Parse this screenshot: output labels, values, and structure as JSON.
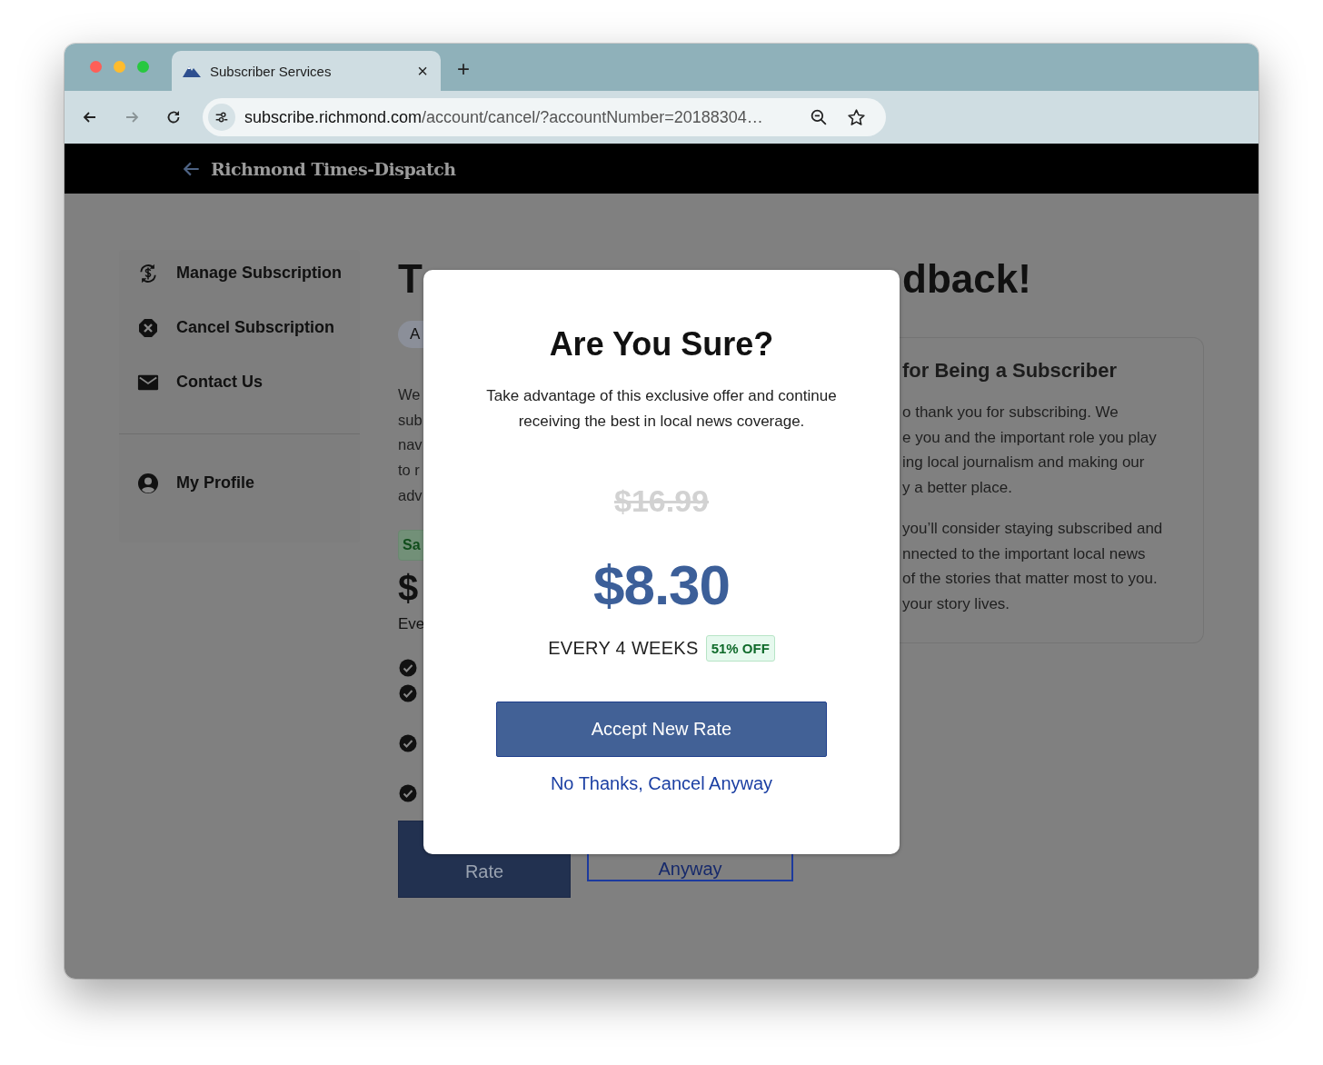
{
  "browser": {
    "tab": {
      "title": "Subscriber Services",
      "close": "×",
      "selected": true
    },
    "new_tab": "+",
    "url": {
      "host": "subscribe.richmond.com",
      "path": "/account/cancel/?accountNumber=20188304…"
    }
  },
  "header": {
    "logo": "Richmond Times-Dispatch"
  },
  "sidebar": {
    "items": [
      {
        "kind": "manage",
        "label": "Manage Subscription"
      },
      {
        "kind": "cancel",
        "label": "Cancel Subscription"
      },
      {
        "kind": "contact",
        "label": "Contact Us"
      }
    ],
    "profile": {
      "kind": "profile",
      "label": "My Profile"
    }
  },
  "main": {
    "title_fragments": [
      "T",
      "dback!"
    ],
    "pill": "A",
    "paragraph_lines": [
      "We",
      "sub",
      "nav",
      "to r",
      "adv"
    ],
    "savings_badge": "Sa",
    "price": "$",
    "frequency": "Eve",
    "buttons": [
      {
        "kind": "primary",
        "label": "Rate"
      },
      {
        "kind": "outline",
        "label": "Anyway"
      }
    ],
    "card": {
      "heading": "for Being a Subscriber",
      "paragraphs": [
        [
          "o thank you for subscribing. We",
          "e you and the important role you play",
          "ing local journalism and making our",
          "y a better place."
        ],
        [
          "you’ll consider staying subscribed and",
          "nnected to the important local news",
          "of the stories that matter most to you.",
          "your story lives."
        ]
      ]
    }
  },
  "modal": {
    "title": "Are You Sure?",
    "text": "Take advantage of this exclusive offer and continue receiving the best in local news coverage.",
    "old_price": "$16.99",
    "price": "$8.30",
    "period": "EVERY 4 WEEKS",
    "discount": "51% OFF",
    "accept": "Accept New Rate",
    "decline": "No Thanks, Cancel Anyway"
  }
}
